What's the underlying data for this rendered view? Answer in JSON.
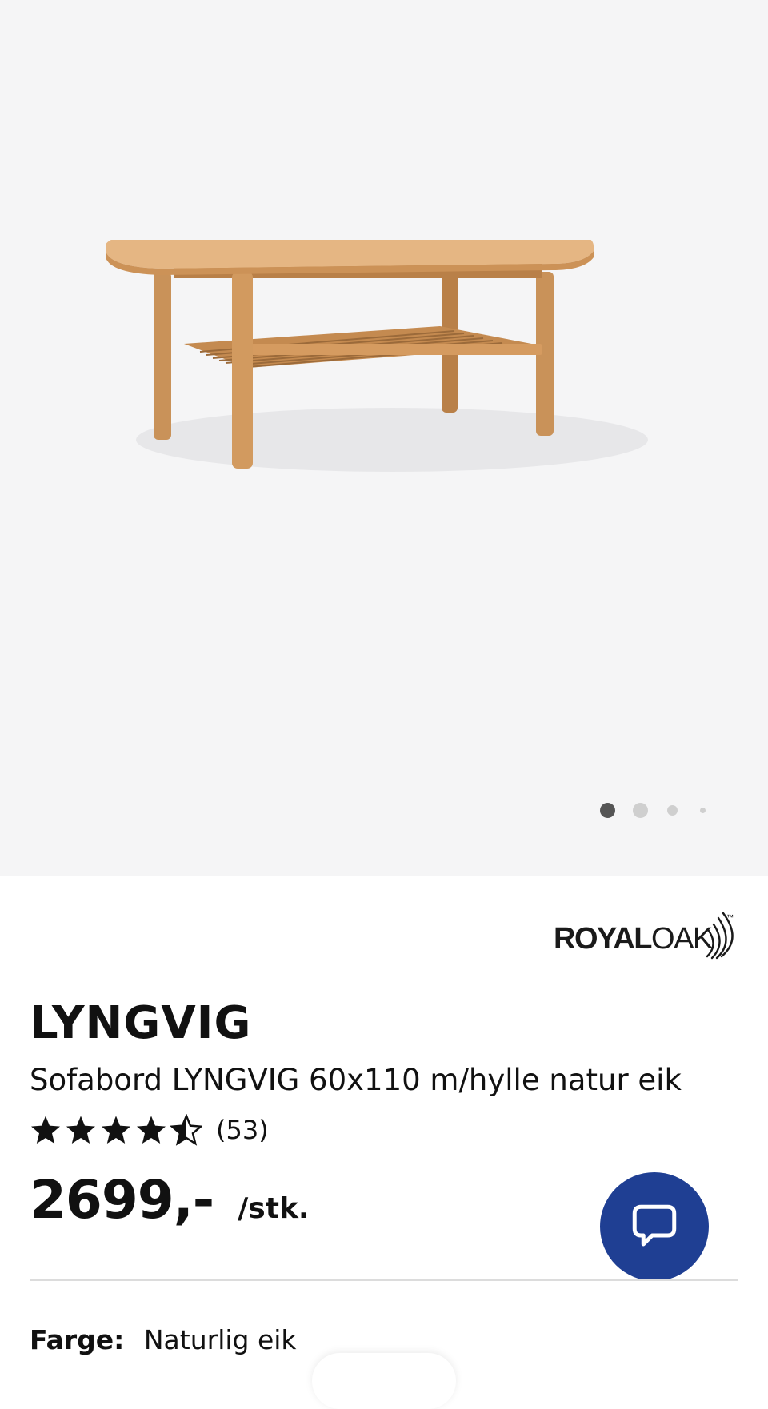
{
  "gallery": {
    "slide_count": 4,
    "active_slide": 1,
    "background_color": "#f5f5f6"
  },
  "brand": {
    "name_bold": "ROYAL",
    "name_light": "OAK",
    "trademark": "™"
  },
  "product": {
    "title": "LYNGVIG",
    "subtitle": "Sofabord LYNGVIG 60x110 m/hylle natur eik",
    "rating": {
      "stars": 4.5,
      "max": 5,
      "count_label": "(53)"
    },
    "price": "2699,-",
    "unit": "/stk."
  },
  "options": {
    "color_label": "Farge:",
    "color_value": "Naturlig eik"
  },
  "chat": {
    "icon": "chat-bubble-icon",
    "color": "#1f3f93"
  }
}
